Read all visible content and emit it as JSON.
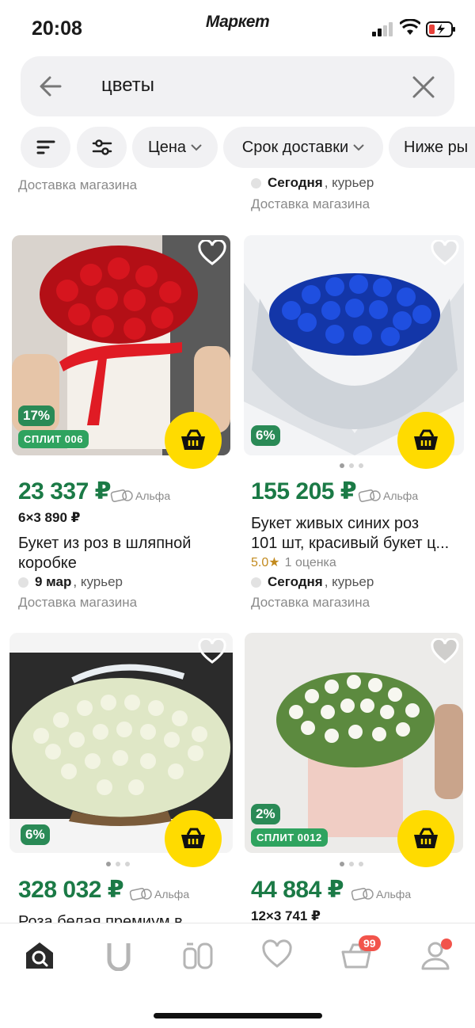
{
  "status": {
    "time": "20:08",
    "brand": "Маркет"
  },
  "search": {
    "query": "цветы"
  },
  "filters": {
    "price": "Цена",
    "delivery_time": "Срок доставки",
    "cheaper": "Ниже ры"
  },
  "top_meta": {
    "left_store": "Доставка магазина",
    "right_day": "Сегодня",
    "right_method": ", курьер",
    "right_store": "Доставка магазина"
  },
  "products": [
    {
      "discount": "17%",
      "split": "СПЛИТ 006",
      "price": "23 337 ₽",
      "alfa": "Альфа",
      "installment": "6×3 890 ₽",
      "title_line1": "Букет из роз в шляпной",
      "title_line2": "коробке",
      "delivery_day": "9 мар",
      "delivery_method": ", курьер",
      "store": "Доставка магазина"
    },
    {
      "discount": "6%",
      "price": "155 205 ₽",
      "alfa": "Альфа",
      "title_line1": "Букет живых синих роз",
      "title_line2": "101 шт, красивый букет ц...",
      "rating": "5.0★",
      "reviews": "1 оценка",
      "delivery_day": "Сегодня",
      "delivery_method": ", курьер",
      "store": "Доставка магазина"
    },
    {
      "discount": "6%",
      "price": "328 032 ₽",
      "alfa": "Альфа",
      "title_line1": "Роза белая премиум в"
    },
    {
      "discount": "2%",
      "split": "СПЛИТ 0012",
      "price": "44 884 ₽",
      "alfa": "Альфа",
      "installment": "12×3 741 ₽"
    }
  ],
  "tabbar": {
    "cart_count": "99"
  },
  "colors": {
    "price": "#1b7a46",
    "cart_button": "#ffdb00",
    "badge": "#2a8a56",
    "notify": "#f2544b"
  },
  "icons": [
    "back-arrow-icon",
    "clear-icon",
    "sort-icon",
    "filter-icon",
    "heart-icon",
    "cart-icon",
    "home-icon",
    "catalog-icon",
    "products-icon",
    "favorites-icon",
    "basket-icon",
    "profile-icon"
  ]
}
